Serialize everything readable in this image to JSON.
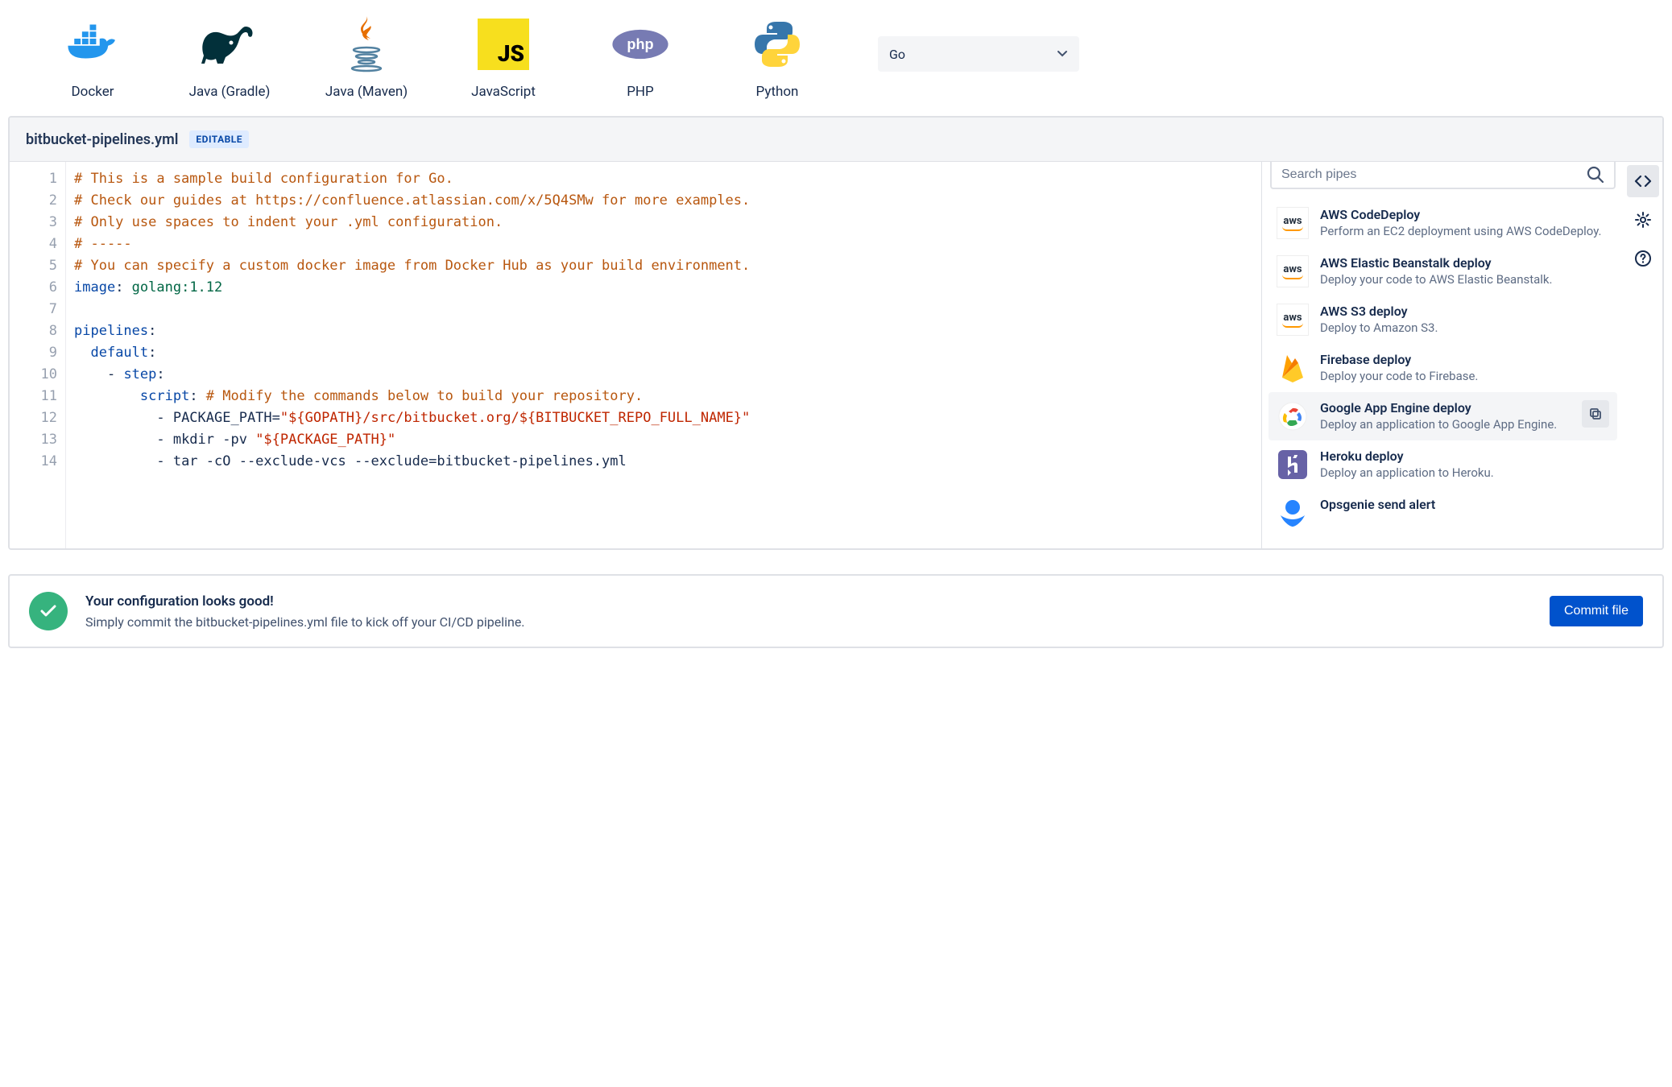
{
  "languages": [
    {
      "id": "docker",
      "label": "Docker"
    },
    {
      "id": "java-gradle",
      "label": "Java (Gradle)"
    },
    {
      "id": "java-maven",
      "label": "Java (Maven)"
    },
    {
      "id": "javascript",
      "label": "JavaScript"
    },
    {
      "id": "php",
      "label": "PHP"
    },
    {
      "id": "python",
      "label": "Python"
    }
  ],
  "dropdown": {
    "selected": "Go"
  },
  "file": {
    "name": "bitbucket-pipelines.yml",
    "badge": "EDITABLE"
  },
  "code_lines": [
    {
      "n": 1,
      "segs": [
        {
          "t": "# This is a sample build configuration for Go.",
          "c": "c-comment"
        }
      ]
    },
    {
      "n": 2,
      "segs": [
        {
          "t": "# Check our guides at https://confluence.atlassian.com/x/5Q4SMw for more examples.",
          "c": "c-comment"
        }
      ]
    },
    {
      "n": 3,
      "segs": [
        {
          "t": "# Only use spaces to indent your .yml configuration.",
          "c": "c-comment"
        }
      ]
    },
    {
      "n": 4,
      "segs": [
        {
          "t": "# -----",
          "c": "c-comment"
        }
      ]
    },
    {
      "n": 5,
      "segs": [
        {
          "t": "# You can specify a custom docker image from Docker Hub as your build environment.",
          "c": "c-comment"
        }
      ]
    },
    {
      "n": 6,
      "segs": [
        {
          "t": "image",
          "c": "c-key"
        },
        {
          "t": ": ",
          "c": "c-colon"
        },
        {
          "t": "golang:1.12",
          "c": "c-value"
        }
      ]
    },
    {
      "n": 7,
      "segs": [
        {
          "t": "",
          "c": ""
        }
      ]
    },
    {
      "n": 8,
      "segs": [
        {
          "t": "pipelines",
          "c": "c-key"
        },
        {
          "t": ":",
          "c": "c-colon"
        }
      ]
    },
    {
      "n": 9,
      "segs": [
        {
          "t": "  ",
          "c": ""
        },
        {
          "t": "default",
          "c": "c-key"
        },
        {
          "t": ":",
          "c": "c-colon"
        }
      ]
    },
    {
      "n": 10,
      "segs": [
        {
          "t": "    - ",
          "c": ""
        },
        {
          "t": "step",
          "c": "c-key"
        },
        {
          "t": ":",
          "c": "c-colon"
        }
      ]
    },
    {
      "n": 11,
      "segs": [
        {
          "t": "        ",
          "c": ""
        },
        {
          "t": "script",
          "c": "c-key"
        },
        {
          "t": ": ",
          "c": "c-colon"
        },
        {
          "t": "# Modify the commands below to build your repository.",
          "c": "c-comment"
        }
      ]
    },
    {
      "n": 12,
      "segs": [
        {
          "t": "          - PACKAGE_PATH=",
          "c": ""
        },
        {
          "t": "\"${GOPATH}/src/bitbucket.org/${BITBUCKET_REPO_FULL_NAME}\"",
          "c": "c-string"
        }
      ]
    },
    {
      "n": 13,
      "segs": [
        {
          "t": "          - mkdir -pv ",
          "c": ""
        },
        {
          "t": "\"${PACKAGE_PATH}\"",
          "c": "c-string"
        }
      ]
    },
    {
      "n": 14,
      "segs": [
        {
          "t": "          - tar -cO --exclude-vcs --exclude=bitbucket-pipelines.yml",
          "c": ""
        }
      ]
    }
  ],
  "search": {
    "placeholder": "Search pipes"
  },
  "pipes": [
    {
      "icon": "aws",
      "title": "AWS CodeDeploy",
      "desc": "Perform an EC2 deployment using AWS CodeDeploy."
    },
    {
      "icon": "aws",
      "title": "AWS Elastic Beanstalk deploy",
      "desc": "Deploy your code to AWS Elastic Beanstalk."
    },
    {
      "icon": "aws",
      "title": "AWS S3 deploy",
      "desc": "Deploy to Amazon S3."
    },
    {
      "icon": "firebase",
      "title": "Firebase deploy",
      "desc": "Deploy your code to Firebase."
    },
    {
      "icon": "gcp",
      "title": "Google App Engine deploy",
      "desc": "Deploy an application to Google App Engine.",
      "hovered": true
    },
    {
      "icon": "heroku",
      "title": "Heroku deploy",
      "desc": "Deploy an application to Heroku."
    },
    {
      "icon": "opsgenie",
      "title": "Opsgenie send alert",
      "desc": ""
    }
  ],
  "commit": {
    "title": "Your configuration looks good!",
    "sub": "Simply commit the bitbucket-pipelines.yml file to kick off your CI/CD pipeline.",
    "button": "Commit file"
  }
}
